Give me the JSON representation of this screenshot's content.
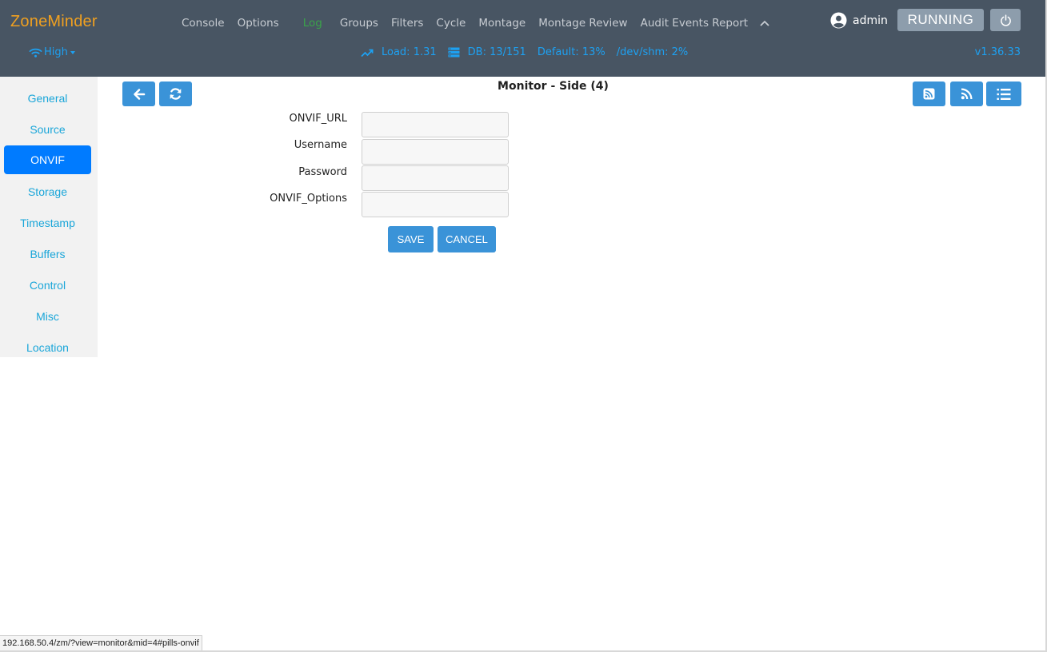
{
  "brand": "ZoneMinder",
  "nav": {
    "items": [
      "Console",
      "Options",
      "Log",
      "Groups",
      "Filters",
      "Cycle",
      "Montage",
      "Montage Review",
      "Audit Events Report"
    ],
    "active": "Log"
  },
  "user": {
    "name": "admin",
    "icon": "user-circle-icon"
  },
  "state_button": "RUNNING",
  "bandwidth": {
    "label": "High",
    "icon": "wifi-icon"
  },
  "stats": {
    "load": "Load: 1.31",
    "db": "DB: 13/151",
    "default_storage": "Default: 13%",
    "shm": "/dev/shm: 2%"
  },
  "version": "v1.36.33",
  "sidebar": {
    "items": [
      "General",
      "Source",
      "ONVIF",
      "Storage",
      "Timestamp",
      "Buffers",
      "Control",
      "Misc",
      "Location"
    ],
    "active": "ONVIF"
  },
  "page_title": "Monitor - Side (4)",
  "form": {
    "fields": [
      {
        "label": "ONVIF_URL",
        "value": ""
      },
      {
        "label": "Username",
        "value": ""
      },
      {
        "label": "Password",
        "value": ""
      },
      {
        "label": "ONVIF_Options",
        "value": ""
      }
    ],
    "save_label": "SAVE",
    "cancel_label": "CANCEL"
  },
  "statusbar_url": "192.168.50.4/zm/?view=monitor&mid=4#pills-onvif",
  "colors": {
    "header_bg": "#485563",
    "brand": "#f0a020",
    "accent": "#1da1f2",
    "button": "#3a93d8",
    "active_tab": "#007bff",
    "log_active": "#3aa34a"
  }
}
